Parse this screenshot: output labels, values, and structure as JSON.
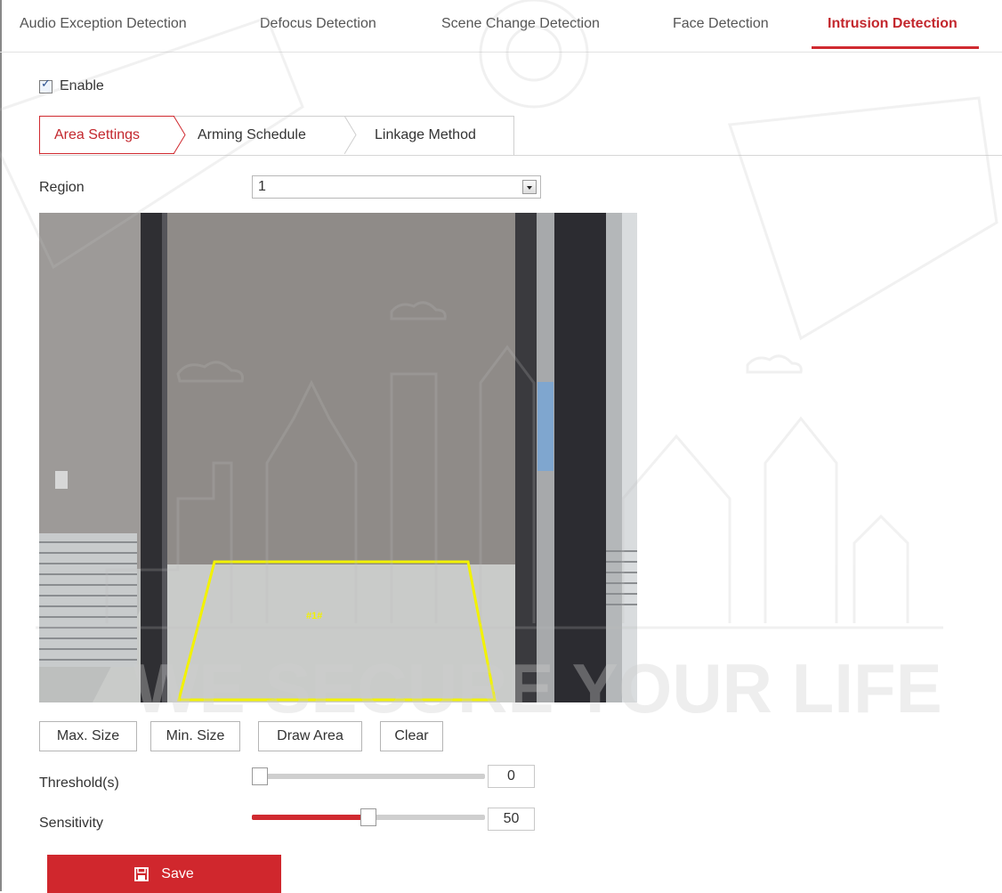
{
  "top_tabs": [
    {
      "label": "Audio Exception Detection"
    },
    {
      "label": "Defocus Detection"
    },
    {
      "label": "Scene Change Detection"
    },
    {
      "label": "Face Detection"
    },
    {
      "label": "Intrusion Detection",
      "active": true
    }
  ],
  "enable": {
    "label": "Enable",
    "checked": true
  },
  "sub_tabs": [
    {
      "label": "Area Settings",
      "active": true
    },
    {
      "label": "Arming Schedule"
    },
    {
      "label": "Linkage Method"
    }
  ],
  "region": {
    "label": "Region",
    "value": "1"
  },
  "buttons": {
    "max_size": "Max. Size",
    "min_size": "Min. Size",
    "draw_area": "Draw Area",
    "clear": "Clear"
  },
  "threshold": {
    "label": "Threshold(s)",
    "value": "0",
    "level": 0
  },
  "sensitivity": {
    "label": "Sensitivity",
    "value": "50",
    "level": 50
  },
  "save": {
    "label": "Save"
  },
  "watermark": {
    "text": "WE SECURE YOUR LIFE"
  },
  "colors": {
    "accent": "#d0272d",
    "region_outline": "#f2f200"
  }
}
